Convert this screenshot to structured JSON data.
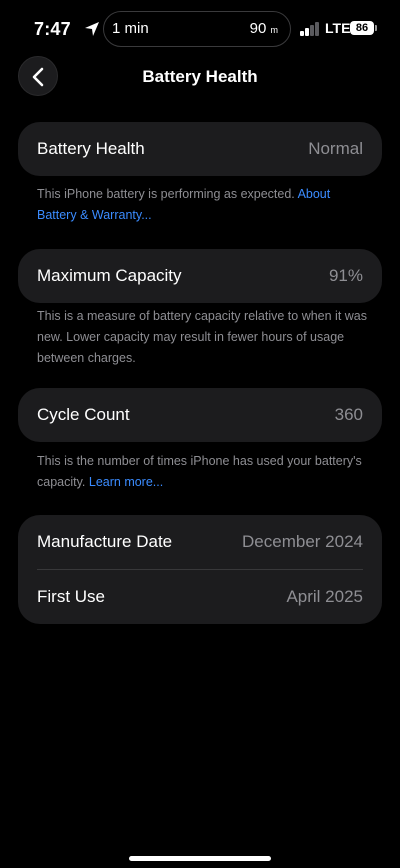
{
  "status_bar": {
    "time": "7:47",
    "island_timer": "1 min",
    "island_distance": "90",
    "island_distance_unit": "m",
    "network": "LTE",
    "battery_level": "86"
  },
  "nav": {
    "title": "Battery Health"
  },
  "health": {
    "label": "Battery Health",
    "value": "Normal",
    "note": "This iPhone battery is performing as expected. ",
    "link": "About Battery & Warranty..."
  },
  "capacity": {
    "label": "Maximum Capacity",
    "value": "91%",
    "note": "This is a measure of battery capacity relative to when it was new. Lower capacity may result in fewer hours of usage between charges."
  },
  "cycles": {
    "label": "Cycle Count",
    "value": "360",
    "note": "This is the number of times iPhone has used your battery's capacity. ",
    "link": "Learn more..."
  },
  "dates": {
    "manufacture_label": "Manufacture Date",
    "manufacture_value": "December 2024",
    "first_use_label": "First Use",
    "first_use_value": "April 2025"
  },
  "colors": {
    "background": "#000000",
    "card": "#1c1c1e",
    "link": "#3b8cff",
    "secondary_text": "#8e8e93"
  }
}
